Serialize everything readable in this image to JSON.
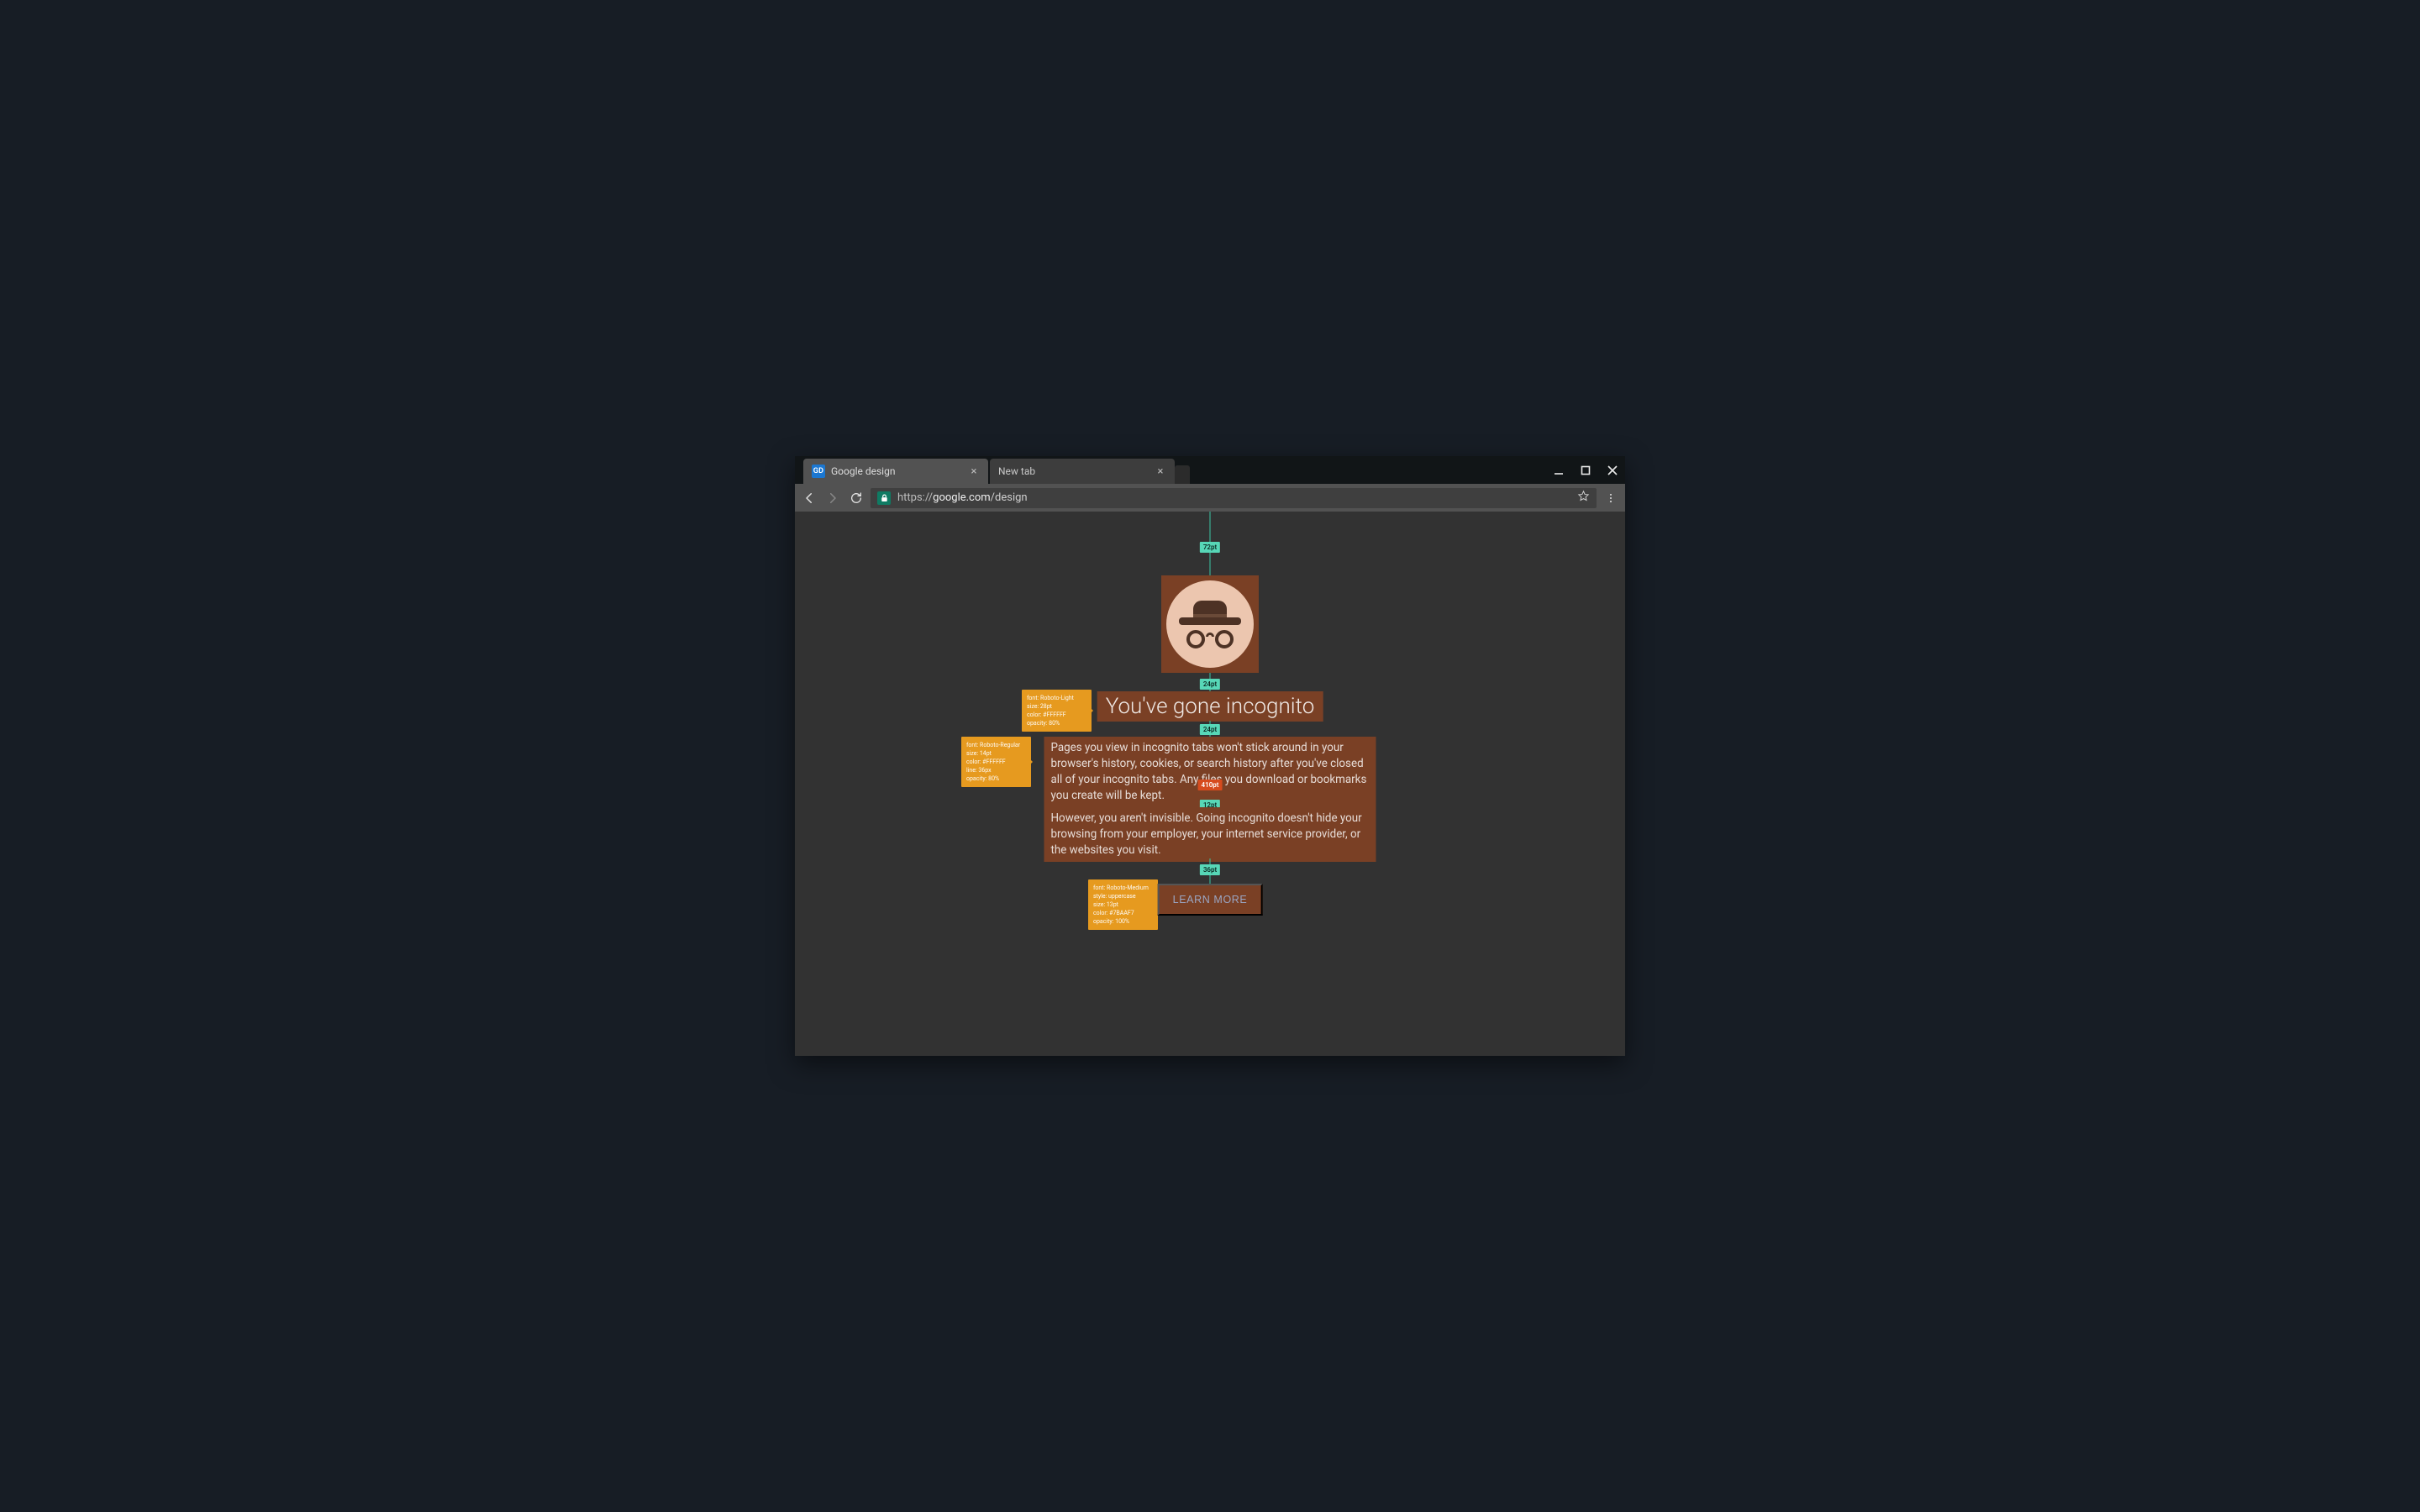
{
  "window": {
    "tabs": [
      {
        "label": "Google design",
        "favicon_text": "GD",
        "active": true
      },
      {
        "label": "New tab",
        "active": false
      }
    ],
    "url": {
      "scheme": "https://",
      "host": "google.com",
      "path": "/design"
    }
  },
  "content": {
    "title": "You've gone incognito",
    "paragraph1": "Pages you view in incognito tabs won't stick around in your browser's history, cookies, or search history after you've closed all of your incognito tabs. Any files you download or bookmarks you create will be kept.",
    "paragraph2": "However, you aren't invisible. Going incognito doesn't hide your browsing from your employer, your internet service provider, or the websites you visit.",
    "button_label": "LEARN MORE"
  },
  "spec": {
    "gap_icon_top": "72pt",
    "gap_icon_title": "24pt",
    "gap_title_body": "24pt",
    "body_width": "410pt",
    "gap_paras": "12pt",
    "gap_body_button": "36pt",
    "callout_title": {
      "line1": "font: Roboto-Light",
      "line2": "size: 28pt",
      "line3": "color: #FFFFFF",
      "line4": "opacity: 80%"
    },
    "callout_body": {
      "line1": "font: Roboto-Regular",
      "line2": "size: 14pt",
      "line3": "color: #FFFFFF",
      "line4": "line: 36px",
      "line5": "opacity: 80%"
    },
    "callout_button": {
      "line1": "font: Roboto-Medium",
      "line2": "style: uppercase",
      "line3": "size: 13pt",
      "line4": "color: #7BAAF7",
      "line5": "opacity: 100%"
    }
  }
}
